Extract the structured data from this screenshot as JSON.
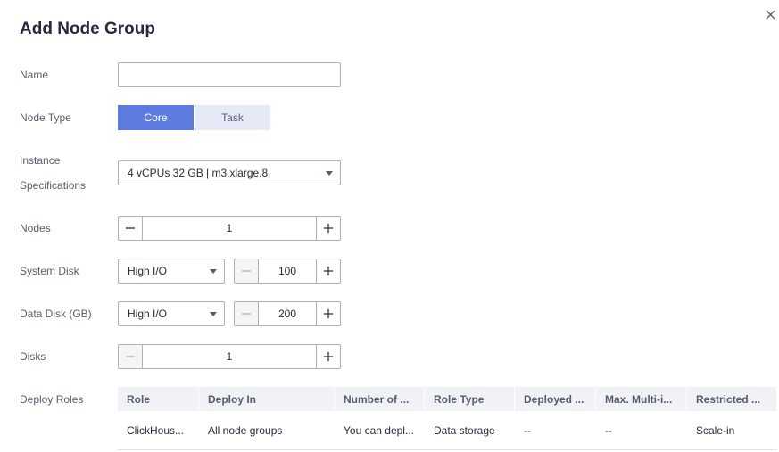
{
  "dialog": {
    "title": "Add Node Group",
    "close_icon": "close-icon"
  },
  "form": {
    "name": {
      "label": "Name",
      "value": "",
      "placeholder": ""
    },
    "node_type": {
      "label": "Node Type",
      "options": [
        "Core",
        "Task"
      ],
      "selected": "Core"
    },
    "instance": {
      "label_line1": "Instance",
      "label_line2": "Specifications",
      "value": "4 vCPUs 32 GB | m3.xlarge.8"
    },
    "nodes": {
      "label": "Nodes",
      "value": "1"
    },
    "system_disk": {
      "label": "System Disk",
      "type": "High I/O",
      "size": "100"
    },
    "data_disk": {
      "label": "Data Disk (GB)",
      "type": "High I/O",
      "size": "200"
    },
    "disks": {
      "label": "Disks",
      "value": "1"
    },
    "deploy_roles": {
      "label": "Deploy Roles"
    }
  },
  "roles_table": {
    "columns": [
      "Role",
      "Deploy In",
      "Number of ...",
      "Role Type",
      "Deployed ...",
      "Max. Multi-i...",
      "Restricted ..."
    ],
    "rows": [
      [
        "ClickHous...",
        "All node groups",
        "You can depl...",
        "Data storage",
        "--",
        "--",
        "Scale-in"
      ]
    ]
  },
  "colors": {
    "accent": "#5e7ce0",
    "segment_inactive": "#e6eaf7",
    "border": "#adb0b8",
    "table_header": "#f0f2f7"
  }
}
